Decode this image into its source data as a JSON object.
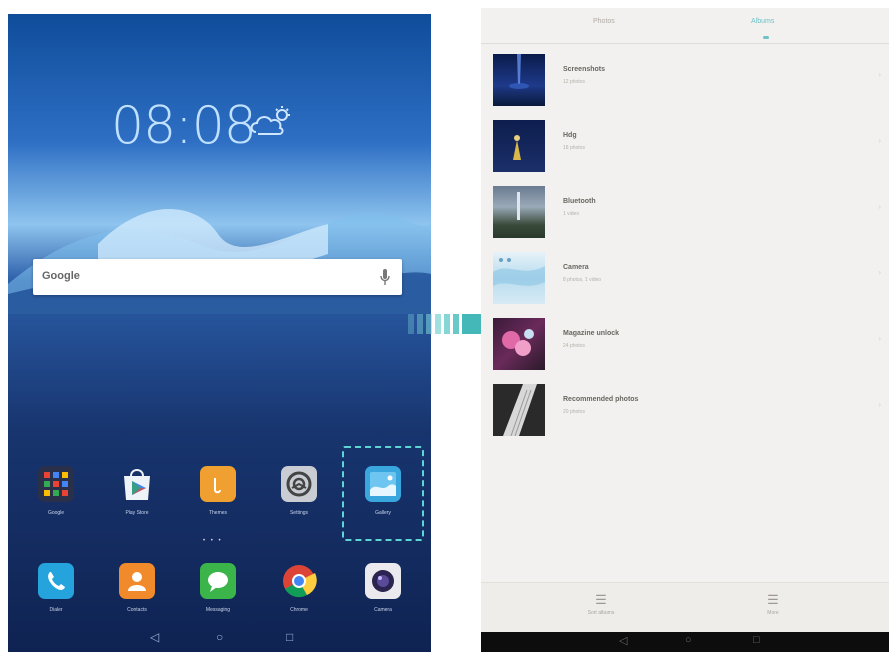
{
  "left_screen": {
    "clock": "08:08",
    "date": "",
    "search": {
      "label": "Google"
    },
    "apps_row1": [
      {
        "label": "Google",
        "icon": "folder-grid-icon"
      },
      {
        "label": "Play Store",
        "icon": "play-store-icon"
      },
      {
        "label": "Themes",
        "icon": "themes-icon"
      },
      {
        "label": "Settings",
        "icon": "settings-gear-icon"
      },
      {
        "label": "Gallery",
        "icon": "gallery-icon"
      }
    ],
    "page_dots": "• • •",
    "apps_row2": [
      {
        "label": "Dialer",
        "icon": "phone-icon"
      },
      {
        "label": "Contacts",
        "icon": "contacts-icon"
      },
      {
        "label": "Messaging",
        "icon": "messaging-icon"
      },
      {
        "label": "Chrome",
        "icon": "chrome-icon"
      },
      {
        "label": "Camera",
        "icon": "camera-icon"
      }
    ],
    "nav": {
      "back": "◁",
      "home": "○",
      "recents": "□"
    },
    "colors": {
      "highlight": "#5fd6d6"
    }
  },
  "right_screen": {
    "tabs": [
      {
        "label": "Photos",
        "active": false
      },
      {
        "label": "Albums",
        "active": true
      }
    ],
    "albums": [
      {
        "name": "Screenshots",
        "count": "12 photos"
      },
      {
        "name": "Hdg",
        "count": "18 photos"
      },
      {
        "name": "Bluetooth",
        "count": "1 video"
      },
      {
        "name": "Camera",
        "count": "8 photos, 1 video"
      },
      {
        "name": "Magazine unlock",
        "count": "24 photos"
      },
      {
        "name": "Recommended photos",
        "count": "20 photos"
      }
    ],
    "bottom_actions": [
      {
        "label": "Sort albums",
        "icon": "list-icon"
      },
      {
        "label": "More",
        "icon": "menu-icon"
      }
    ],
    "nav": {
      "back": "◁",
      "home": "○",
      "recents": "□"
    },
    "colors": {
      "accent": "#6cc3c8"
    }
  }
}
